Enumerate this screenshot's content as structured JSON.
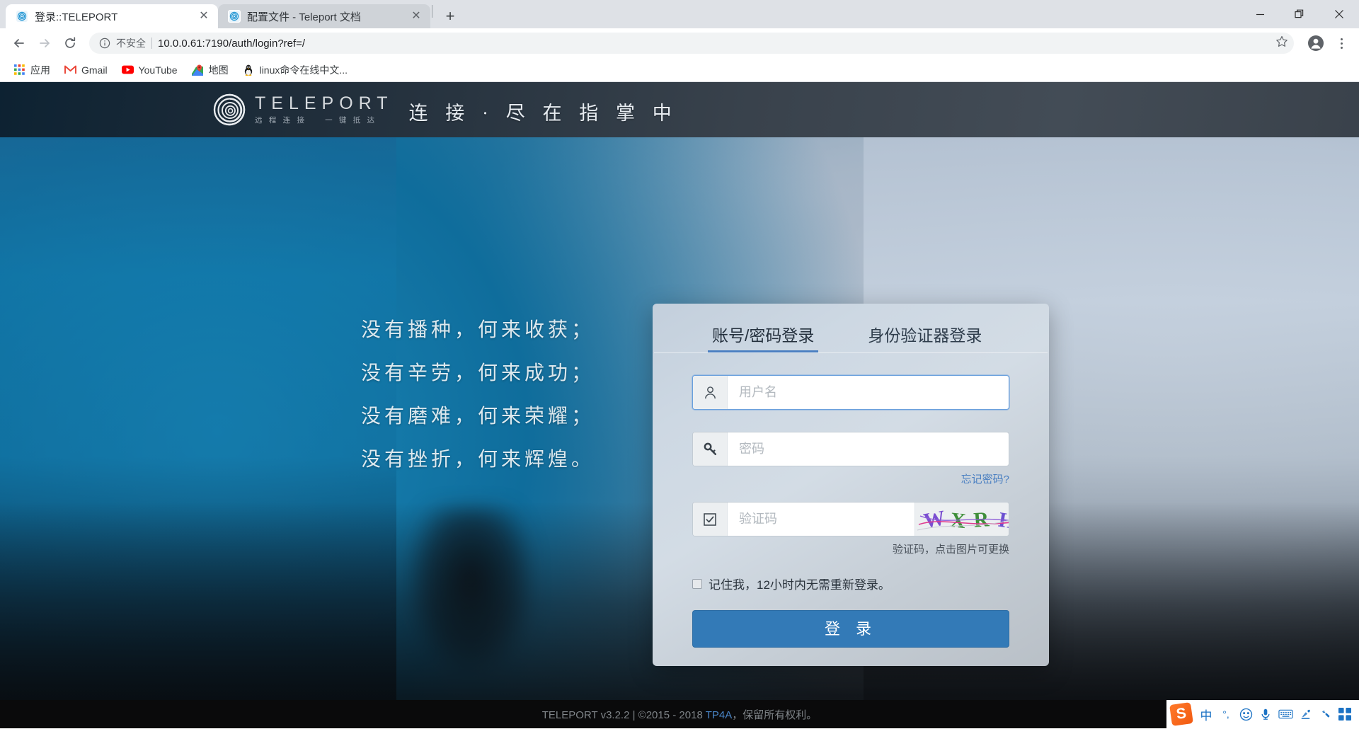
{
  "browser": {
    "tabs": [
      {
        "title": "登录::TELEPORT",
        "favicon": "teleport-spiral-icon",
        "active": true,
        "close_label": "✕"
      },
      {
        "title": "配置文件 - Teleport 文档",
        "favicon": "teleport-spiral-icon",
        "active": false,
        "close_label": "✕"
      }
    ],
    "new_tab_label": "+",
    "window_controls": {
      "minimize": "minimize-icon",
      "restore": "restore-icon",
      "close": "close-icon"
    },
    "nav": {
      "back": "back-arrow-icon",
      "forward": "forward-arrow-icon",
      "reload": "reload-icon"
    },
    "omnibox": {
      "security_label": "不安全",
      "separator": "|",
      "url": "10.0.0.61:7190/auth/login?ref=/",
      "star_icon": "star-icon"
    },
    "profile_icon": "profile-avatar-icon",
    "menu_icon": "three-dot-menu-icon",
    "bookmarks": [
      {
        "label": "应用",
        "icon": "apps-grid-icon"
      },
      {
        "label": "Gmail",
        "icon": "gmail-icon"
      },
      {
        "label": "YouTube",
        "icon": "youtube-icon"
      },
      {
        "label": "地图",
        "icon": "google-maps-icon"
      },
      {
        "label": "linux命令在线中文...",
        "icon": "linux-penguin-icon"
      }
    ]
  },
  "site": {
    "header": {
      "logo_icon": "teleport-spiral-logo",
      "brand_name": "TELEPORT",
      "brand_subtitle": "远 程 连 接 　 一 键 抵 达",
      "slogan": "连 接 · 尽 在 指 掌 中"
    },
    "poem": [
      "没有播种，何来收获；",
      "没有辛劳，何来成功；",
      "没有磨难，何来荣耀；",
      "没有挫折，何来辉煌。"
    ],
    "footer": {
      "prefix": "TELEPORT v3.2.2 | ©2015 - 2018 ",
      "brand": "TP4A",
      "suffix": "，保留所有权利。"
    }
  },
  "login": {
    "tabs": [
      {
        "label": "账号/密码登录",
        "active": true
      },
      {
        "label": "身份验证器登录",
        "active": false
      }
    ],
    "username": {
      "placeholder": "用户名",
      "value": "",
      "icon": "user-icon"
    },
    "password": {
      "placeholder": "密码",
      "value": "",
      "icon": "key-icon"
    },
    "forgot_password": "忘记密码?",
    "captcha": {
      "placeholder": "验证码",
      "value": "",
      "icon": "checkbox-icon",
      "image_text": "WXRH",
      "hint": "验证码，点击图片可更换"
    },
    "remember": {
      "label": "记住我，12小时内无需重新登录。",
      "checked": false
    },
    "submit_label": "登 录",
    "accent_color": "#337ab7",
    "link_color": "#4a7fc1"
  },
  "ime": {
    "logo": "sogou-s-logo",
    "items": [
      {
        "icon": "chinese-mode-icon",
        "glyph": "中"
      },
      {
        "icon": "punctuation-mode-icon",
        "glyph": "°,"
      },
      {
        "icon": "emoji-icon",
        "glyph": "☺"
      },
      {
        "icon": "microphone-icon",
        "glyph": "🎤"
      },
      {
        "icon": "soft-keyboard-icon",
        "glyph": "⌨"
      },
      {
        "icon": "handwriting-icon",
        "glyph": "✍"
      },
      {
        "icon": "toolbox-icon",
        "glyph": "⚒"
      },
      {
        "icon": "panel-grid-icon",
        "glyph": "▦"
      }
    ]
  }
}
